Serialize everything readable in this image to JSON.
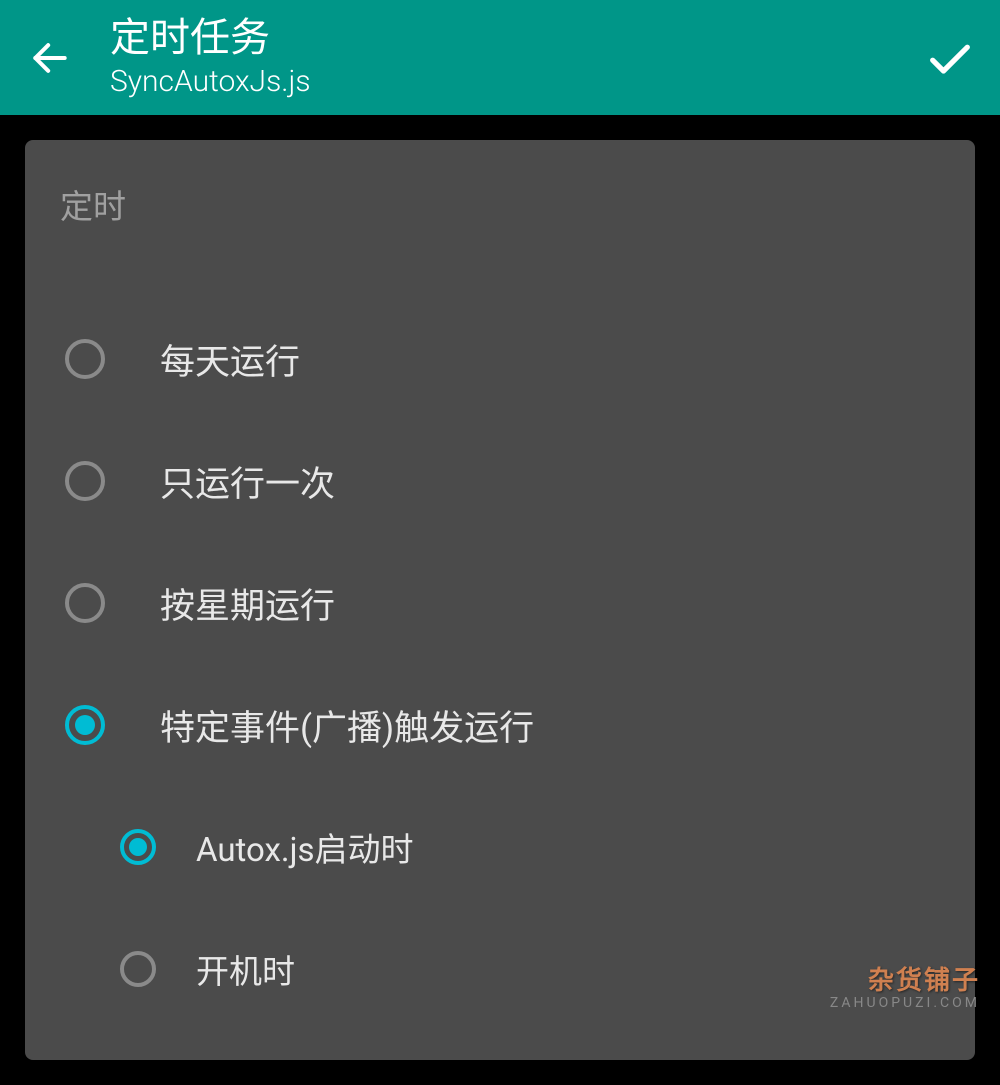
{
  "header": {
    "title": "定时任务",
    "subtitle": "SyncAutoxJs.js"
  },
  "section_label": "定时",
  "options": [
    {
      "label": "每天运行",
      "selected": false
    },
    {
      "label": "只运行一次",
      "selected": false
    },
    {
      "label": "按星期运行",
      "selected": false
    },
    {
      "label": "特定事件(广播)触发运行",
      "selected": true
    }
  ],
  "sub_options": [
    {
      "label": "Autox.js启动时",
      "selected": true
    },
    {
      "label": "开机时",
      "selected": false
    }
  ],
  "watermark": {
    "main": "杂货铺子",
    "sub": "ZAHUOPUZI.COM"
  }
}
